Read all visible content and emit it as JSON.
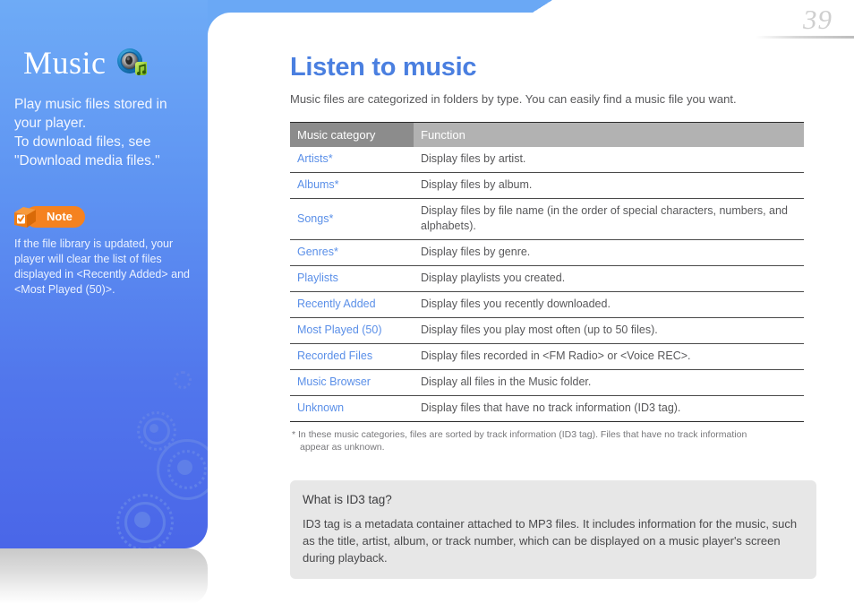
{
  "page": {
    "number": "39"
  },
  "sidebar": {
    "chapter_title": "Music",
    "music_icon_name": "speaker-music-note-icon",
    "description_lines": [
      "Play music files stored in",
      "your player.",
      "To download files, see",
      "\"Download media files.\""
    ],
    "note": {
      "badge_label": "Note",
      "badge_icon_name": "note-cube-check-icon",
      "text": "If the file library is updated, your player will clear the list of files displayed in <Recently Added> and <Most Played (50)>."
    },
    "colors": {
      "gradient_top": "#6eabf6",
      "gradient_bottom": "#4a66e8",
      "accent_orange": "#f58220"
    }
  },
  "main": {
    "heading": "Listen to music",
    "heading_color": "#4a7fe0",
    "intro": "Music files are categorized in folders by type. You can easily find a music file you want.",
    "table": {
      "headers": [
        "Music category",
        "Function"
      ],
      "header_colors": [
        "#8c8c8c",
        "#b2b2b2"
      ],
      "rows": [
        {
          "category": "Artists*",
          "function": "Display files by artist."
        },
        {
          "category": "Albums*",
          "function": "Display files by album."
        },
        {
          "category": "Songs*",
          "function": "Display files by file name (in the order of special characters, numbers, and alphabets)."
        },
        {
          "category": "Genres*",
          "function": "Display files by genre."
        },
        {
          "category": "Playlists",
          "function": "Display playlists you created."
        },
        {
          "category": "Recently Added",
          "function": "Display files you recently downloaded."
        },
        {
          "category": "Most Played (50)",
          "function": "Display files you play most often (up to 50 files)."
        },
        {
          "category": "Recorded Files",
          "function": "Display files recorded in <FM Radio> or <Voice REC>."
        },
        {
          "category": "Music Browser",
          "function": "Display all files in the Music folder."
        },
        {
          "category": "Unknown",
          "function": "Display files that have no track information (ID3 tag)."
        }
      ]
    },
    "footnote": {
      "marker": "*",
      "line1": "In these music categories, files are sorted by track information (ID3 tag). Files that have no track information",
      "line2": "appear as unknown."
    },
    "info_box": {
      "title": "What is ID3 tag?",
      "body": "ID3 tag is a metadata container attached to MP3 files. It includes information for the music, such as the title, artist, album, or track number, which can be displayed on a music player's screen during playback."
    }
  }
}
